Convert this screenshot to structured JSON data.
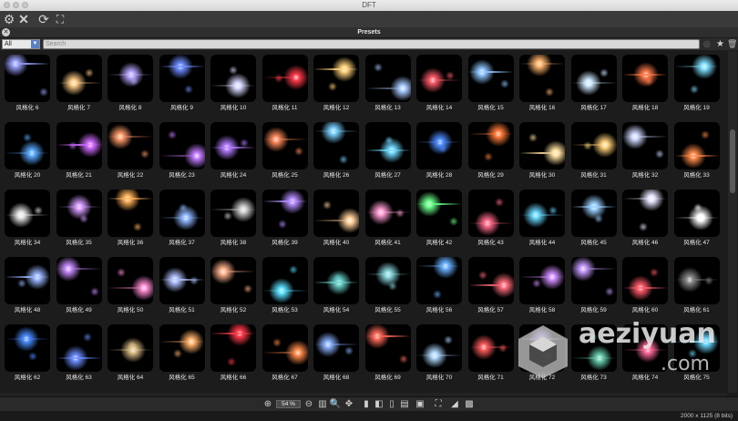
{
  "window": {
    "title": "DFT"
  },
  "toolbar": {
    "icons": [
      "gear-icon",
      "close-x-icon",
      "fit-frame-icon",
      "refresh-icon",
      "compare-frame-icon"
    ]
  },
  "panel": {
    "title": "Presets"
  },
  "filter": {
    "selected": "All"
  },
  "search": {
    "placeholder": "Search"
  },
  "presets": [
    {
      "label": "风格化 6",
      "c": "#9aa3ff"
    },
    {
      "label": "风格化 7",
      "c": "#ffcc88"
    },
    {
      "label": "风格化 8",
      "c": "#b9a6ff"
    },
    {
      "label": "风格化 9",
      "c": "#6e8cff"
    },
    {
      "label": "风格化 10",
      "c": "#d8d8ff"
    },
    {
      "label": "风格化 11",
      "c": "#ff3a4a"
    },
    {
      "label": "风格化 12",
      "c": "#ffd27a"
    },
    {
      "label": "风格化 13",
      "c": "#a8c8ff"
    },
    {
      "label": "风格化 14",
      "c": "#ff5a6a"
    },
    {
      "label": "风格化 15",
      "c": "#8fc6ff"
    },
    {
      "label": "风格化 16",
      "c": "#ffb36b"
    },
    {
      "label": "风格化 17",
      "c": "#cfeaff"
    },
    {
      "label": "风格化 18",
      "c": "#ff7a4a"
    },
    {
      "label": "风格化 19",
      "c": "#7fe0ff"
    },
    {
      "label": "风格化 20",
      "c": "#5aa8ff"
    },
    {
      "label": "风格化 21",
      "c": "#d06bff"
    },
    {
      "label": "风格化 22",
      "c": "#ff9a6a"
    },
    {
      "label": "风格化 23",
      "c": "#c27bff"
    },
    {
      "label": "风格化 24",
      "c": "#b27bff"
    },
    {
      "label": "风格化 25",
      "c": "#ff8a5a"
    },
    {
      "label": "风格化 26",
      "c": "#7ad0ff"
    },
    {
      "label": "风格化 27",
      "c": "#6fd8ff"
    },
    {
      "label": "风格化 28",
      "c": "#4f8cff"
    },
    {
      "label": "风格化 29",
      "c": "#ff7a3a"
    },
    {
      "label": "风格化 30",
      "c": "#ffe0a0"
    },
    {
      "label": "风格化 31",
      "c": "#ffd27a"
    },
    {
      "label": "风格化 32",
      "c": "#cfd8ff"
    },
    {
      "label": "风格化 33",
      "c": "#ff8a4a"
    },
    {
      "label": "风格化 34",
      "c": "#e6e6e6"
    },
    {
      "label": "风格化 35",
      "c": "#d49aff"
    },
    {
      "label": "风格化 36",
      "c": "#ffb25a"
    },
    {
      "label": "风格化 37",
      "c": "#8fb6ff"
    },
    {
      "label": "风格化 38",
      "c": "#cfcfcf"
    },
    {
      "label": "风格化 39",
      "c": "#b48cff"
    },
    {
      "label": "风格化 40",
      "c": "#ffcf9a"
    },
    {
      "label": "风格化 41",
      "c": "#ff9ad0"
    },
    {
      "label": "风格化 42",
      "c": "#6aff8a"
    },
    {
      "label": "风格化 43",
      "c": "#ff6a8a"
    },
    {
      "label": "风格化 44",
      "c": "#6ad8ff"
    },
    {
      "label": "风格化 45",
      "c": "#9ad0ff"
    },
    {
      "label": "风格化 46",
      "c": "#e6e6ff"
    },
    {
      "label": "风格化 47",
      "c": "#ffffff"
    },
    {
      "label": "风格化 48",
      "c": "#9ab6ff"
    },
    {
      "label": "风格化 49",
      "c": "#c88cff"
    },
    {
      "label": "风格化 50",
      "c": "#ff8ad0"
    },
    {
      "label": "风格化 51",
      "c": "#b0c0ff"
    },
    {
      "label": "风格化 52",
      "c": "#ffb08a"
    },
    {
      "label": "风格化 53",
      "c": "#5ae0ff"
    },
    {
      "label": "风格化 54",
      "c": "#6ad0c8"
    },
    {
      "label": "风格化 55",
      "c": "#8ad8e0"
    },
    {
      "label": "风格化 56",
      "c": "#6ab0ff"
    },
    {
      "label": "风格化 57",
      "c": "#ff6a7a"
    },
    {
      "label": "风格化 58",
      "c": "#d08cff"
    },
    {
      "label": "风格化 59",
      "c": "#c49aff"
    },
    {
      "label": "风格化 60",
      "c": "#ff5a6a"
    },
    {
      "label": "风格化 61",
      "c": "#8a8a8a"
    },
    {
      "label": "风格化 62",
      "c": "#4a8cff"
    },
    {
      "label": "风格化 63",
      "c": "#6a8cff"
    },
    {
      "label": "风格化 64",
      "c": "#e0c08a"
    },
    {
      "label": "风格化 65",
      "c": "#ffb06a"
    },
    {
      "label": "风格化 66",
      "c": "#ff3a4a"
    },
    {
      "label": "风格化 67",
      "c": "#ff8a4a"
    },
    {
      "label": "风格化 68",
      "c": "#8ab0ff"
    },
    {
      "label": "风格化 69",
      "c": "#ff6a5a"
    },
    {
      "label": "风格化 70",
      "c": "#b0d8ff"
    },
    {
      "label": "风格化 71",
      "c": "#ff5a5a"
    },
    {
      "label": "风格化 72",
      "c": "#c09aff"
    },
    {
      "label": "风格化 73",
      "c": "#6ad0b0"
    },
    {
      "label": "风格化 74",
      "c": "#ff6a9a"
    },
    {
      "label": "风格化 75",
      "c": "#6ad8ff"
    }
  ],
  "bottombar": {
    "zoom": "54 %"
  },
  "status": {
    "text": "2000 x 1125 (8 bits)"
  },
  "watermark": {
    "line1": "aeziyuan",
    "line2": ".com"
  }
}
